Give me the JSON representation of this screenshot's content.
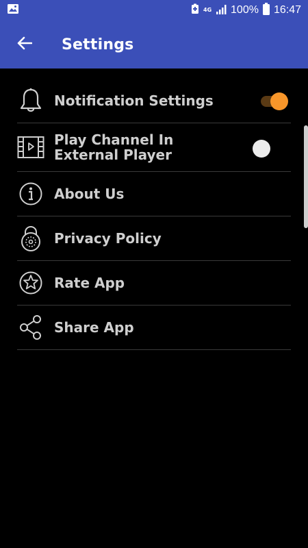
{
  "status_bar": {
    "battery": "100%",
    "time": "16:47",
    "network": "4G"
  },
  "app_bar": {
    "title": "Settings"
  },
  "settings": {
    "items": [
      {
        "label": "Notification Settings",
        "icon": "bell-icon",
        "control": "toggle",
        "enabled": true
      },
      {
        "label": "Play Channel In External Player",
        "icon": "video-icon",
        "control": "toggle",
        "enabled": false
      },
      {
        "label": "About Us",
        "icon": "info-icon",
        "control": "none"
      },
      {
        "label": "Privacy Policy",
        "icon": "lock-icon",
        "control": "none"
      },
      {
        "label": "Rate App",
        "icon": "star-icon",
        "control": "none"
      },
      {
        "label": "Share App",
        "icon": "share-icon",
        "control": "none"
      }
    ]
  },
  "colors": {
    "primary": "#3b4fb8",
    "accent": "#f8962a",
    "background": "#000000"
  }
}
